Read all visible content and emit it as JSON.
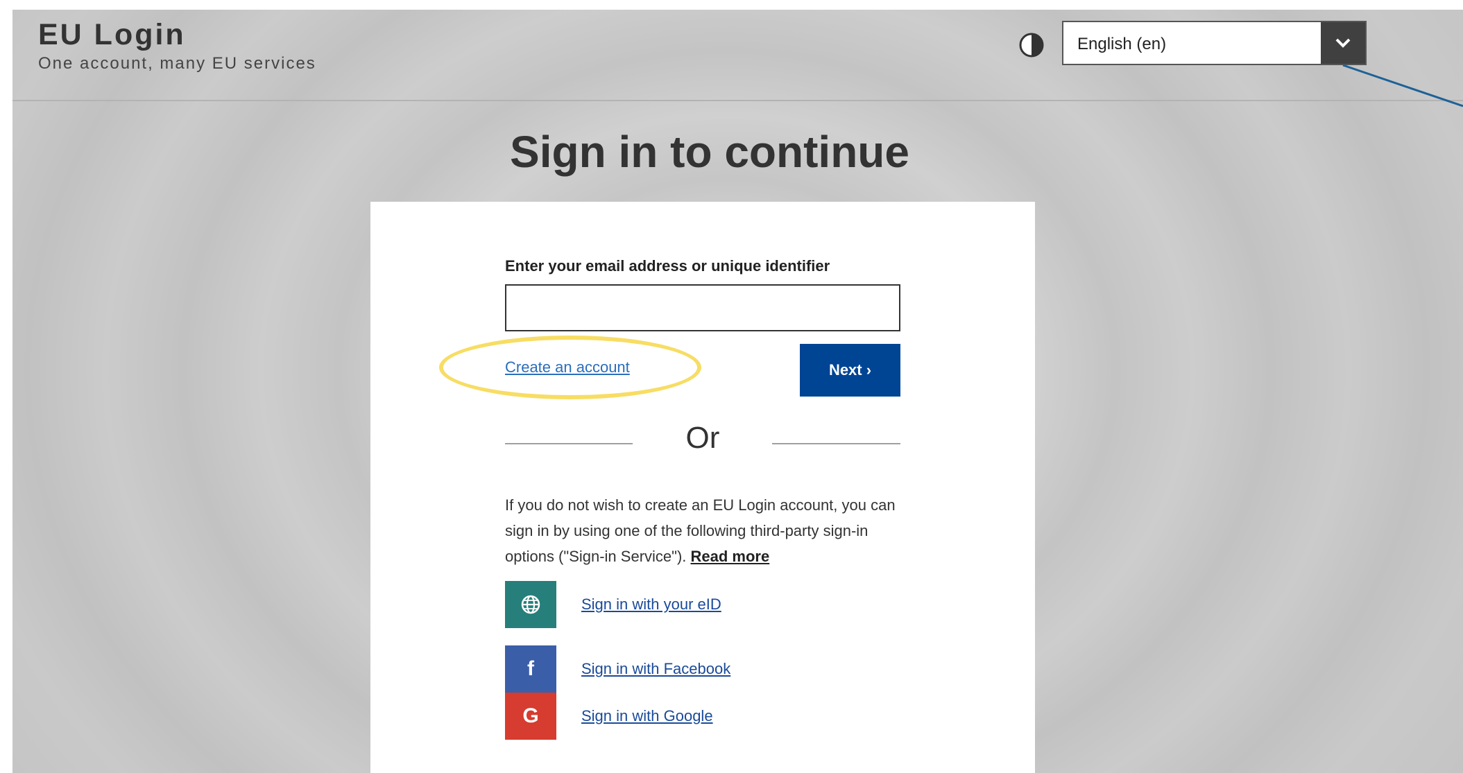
{
  "header": {
    "title": "EU Login",
    "subtitle": "One account, many EU services",
    "contrast_icon": "contrast-icon",
    "language": {
      "selected": "English (en)",
      "chevron_icon": "chevron-down-icon"
    }
  },
  "main": {
    "heading": "Sign in to continue",
    "form": {
      "email_label": "Enter your email address or unique identifier",
      "email_value": "",
      "create_account_link": "Create an account",
      "next_button": "Next ›"
    },
    "divider_text": "Or",
    "info": {
      "text": "If you do not wish to create an EU Login account, you can sign in by using one of the following third-party sign-in options (\"Sign-in Service\").",
      "read_more": "Read more"
    },
    "providers": [
      {
        "label": "Sign in with your eID",
        "icon": "globe-icon",
        "color": "#267f7a"
      },
      {
        "label": "Sign in with Facebook",
        "icon": "facebook-icon",
        "glyph": "f",
        "color": "#3b5ea8"
      },
      {
        "label": "Sign in with Google",
        "icon": "google-icon",
        "glyph": "G",
        "color": "#d63c2f"
      }
    ]
  },
  "annotations": {
    "highlight_color": "#f7dd63",
    "arrow_color": "#1d6197"
  }
}
